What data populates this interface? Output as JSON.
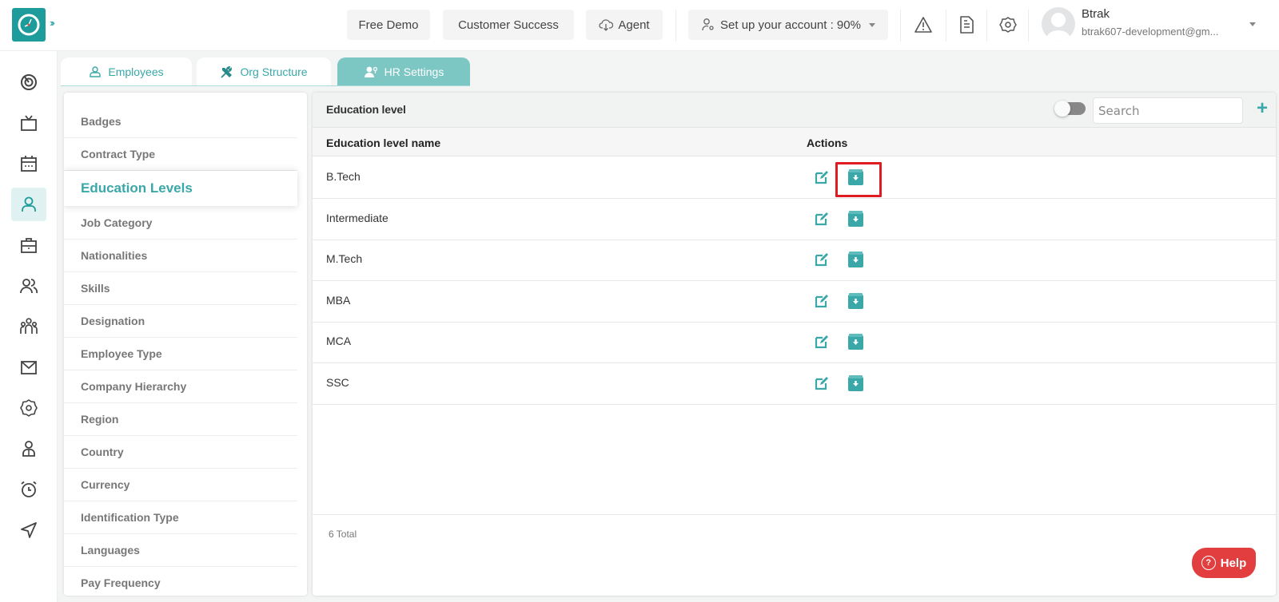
{
  "header": {
    "buttons": {
      "free_demo": "Free Demo",
      "customer_success": "Customer Success",
      "agent": "Agent",
      "setup_account": "Set up your account : 90%"
    },
    "icons": [
      "warning-icon",
      "document-icon",
      "settings-icon"
    ],
    "user": {
      "name": "Btrak",
      "email": "btrak607-development@gm..."
    }
  },
  "leftnav": {
    "items": [
      {
        "icon": "dashboard-icon"
      },
      {
        "icon": "tv-icon"
      },
      {
        "icon": "calendar-icon"
      },
      {
        "icon": "employee-icon",
        "active": true
      },
      {
        "icon": "briefcase-icon"
      },
      {
        "icon": "users-icon"
      },
      {
        "icon": "team-icon"
      },
      {
        "icon": "mail-icon"
      },
      {
        "icon": "settings-icon"
      },
      {
        "icon": "profile-icon"
      },
      {
        "icon": "alarm-icon"
      },
      {
        "icon": "send-icon"
      }
    ]
  },
  "tabs": [
    {
      "label": "Employees",
      "icon": "user-icon"
    },
    {
      "label": "Org Structure",
      "icon": "tools-icon"
    },
    {
      "label": "HR Settings",
      "icon": "user-settings-icon",
      "active": true
    }
  ],
  "settings_menu": {
    "items": [
      {
        "label": "Badges"
      },
      {
        "label": "Contract Type"
      },
      {
        "label": "Education Levels",
        "active": true
      },
      {
        "label": "Job Category"
      },
      {
        "label": "Nationalities"
      },
      {
        "label": "Skills"
      },
      {
        "label": "Designation"
      },
      {
        "label": "Employee Type"
      },
      {
        "label": "Company Hierarchy"
      },
      {
        "label": "Region"
      },
      {
        "label": "Country"
      },
      {
        "label": "Currency"
      },
      {
        "label": "Identification Type"
      },
      {
        "label": "Languages"
      },
      {
        "label": "Pay Frequency"
      }
    ]
  },
  "card": {
    "title": "Education level",
    "search_placeholder": "Search",
    "add_label": "+",
    "columns": {
      "name": "Education level name",
      "actions": "Actions"
    },
    "rows": [
      {
        "name": "B.Tech",
        "highlighted": true
      },
      {
        "name": "Intermediate"
      },
      {
        "name": "M.Tech"
      },
      {
        "name": "MBA"
      },
      {
        "name": "MCA"
      },
      {
        "name": "SSC"
      }
    ],
    "total": "6 Total"
  },
  "help": {
    "label": "Help",
    "icon": "?"
  },
  "colors": {
    "accent": "#3aa8a8",
    "brand": "#1e9b9b",
    "tab_active": "#7cc7c4",
    "highlight": "#e01b22",
    "help": "#e23d3f"
  }
}
